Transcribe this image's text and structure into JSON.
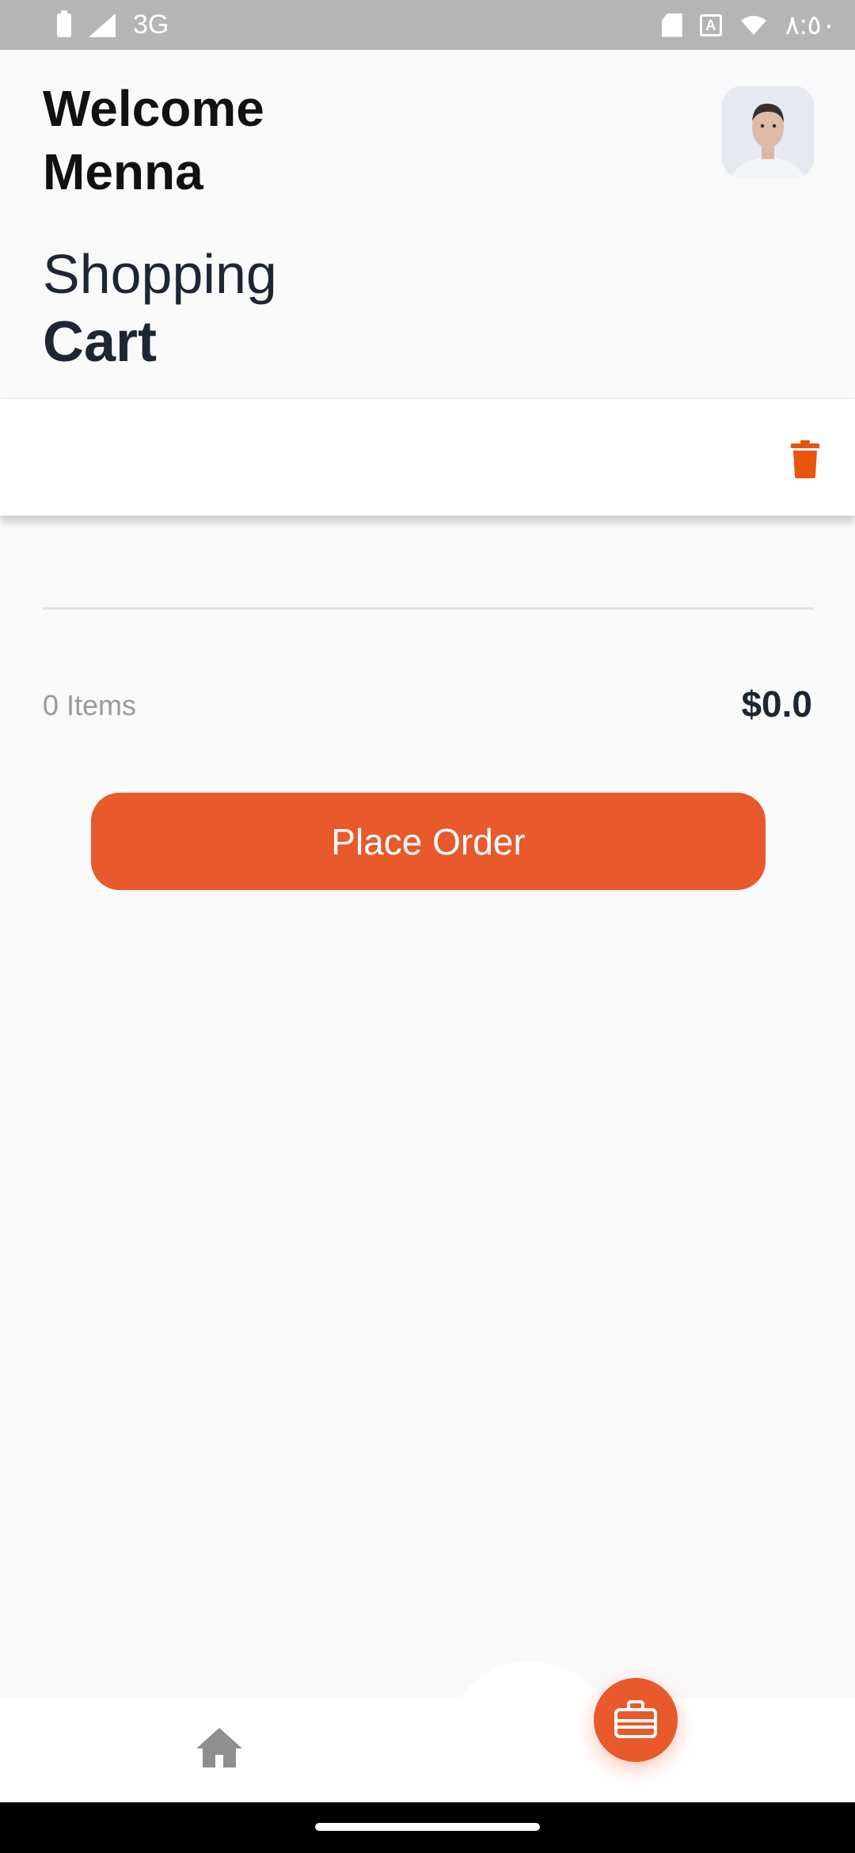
{
  "status_bar": {
    "network": "3G",
    "time": "٨:٥٠",
    "icons": [
      "battery-icon",
      "signal-icon",
      "sd-card-icon",
      "keyboard-a-icon",
      "wifi-icon"
    ]
  },
  "header": {
    "welcome_line1": "Welcome",
    "welcome_line2": "Menna",
    "title_light": "Shopping",
    "title_bold": "Cart"
  },
  "summary": {
    "items_count": "0 Items",
    "total": "$0.0"
  },
  "actions": {
    "place_order_label": "Place Order"
  },
  "bottom_nav": {
    "items": [
      "home-icon",
      "briefcase-icon"
    ]
  },
  "colors": {
    "accent": "#e8592b",
    "trash": "#e8550f",
    "text_dark": "#1e2533",
    "background": "#fafafa"
  }
}
